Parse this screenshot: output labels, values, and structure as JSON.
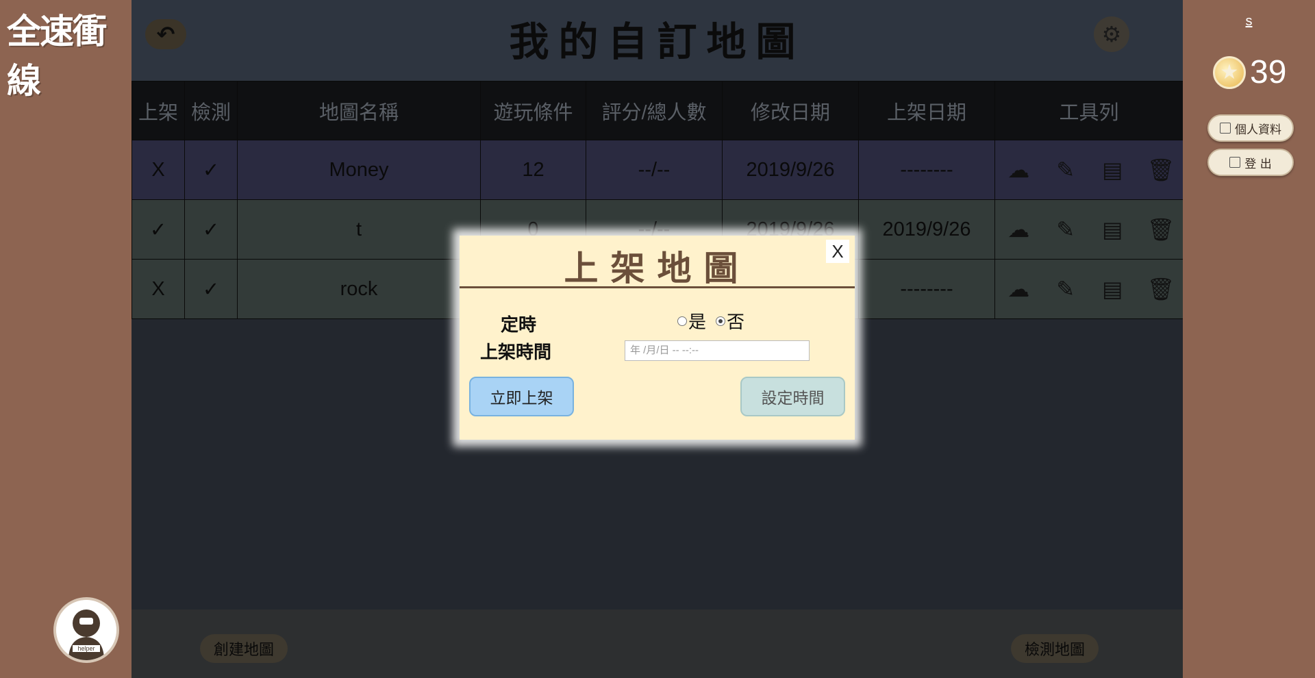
{
  "app": {
    "logo": "全速衝線"
  },
  "user": {
    "name": "s",
    "coins": "39"
  },
  "side_buttons": {
    "profile": "個人資料",
    "logout": "登 出"
  },
  "header": {
    "title": "我的自訂地圖"
  },
  "table": {
    "headers": [
      "上架",
      "檢測",
      "地圖名稱",
      "遊玩條件",
      "評分/總人數",
      "修改日期",
      "上架日期",
      "工具列"
    ],
    "rows": [
      {
        "published": "X",
        "checked": "✓",
        "name": "Money",
        "condition": "12",
        "rating": "--/--",
        "modified": "2019/9/26",
        "publish_date": "--------"
      },
      {
        "published": "✓",
        "checked": "✓",
        "name": "t",
        "condition": "0",
        "rating": "--/--",
        "modified": "2019/9/26",
        "publish_date": "2019/9/26"
      },
      {
        "published": "X",
        "checked": "✓",
        "name": "rock",
        "condition": "",
        "rating": "",
        "modified": "",
        "publish_date": "--------"
      }
    ]
  },
  "bottom": {
    "create_map": "創建地圖",
    "check_map": "檢測地圖"
  },
  "modal": {
    "title": "上架地圖",
    "close": "X",
    "scheduled_label": "定時",
    "publish_time_label": "上架時間",
    "radio_yes": "是",
    "radio_no": "否",
    "datetime_placeholder": "年 /月/日 -- --:--",
    "publish_now": "立即上架",
    "set_time": "設定時間"
  },
  "colors": {
    "modal_bg": "#fff2cc",
    "modal_title": "#6b4f3a",
    "primary_button": "#a9d3f5",
    "sidebar": "#8d6451"
  }
}
